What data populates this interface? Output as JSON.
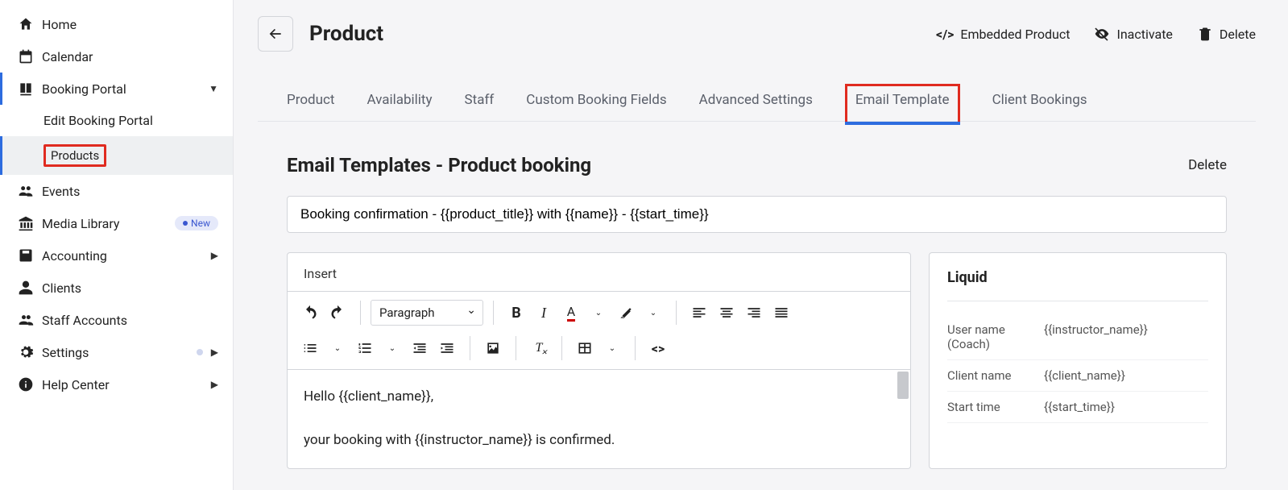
{
  "sidebar": {
    "items": [
      {
        "label": "Home"
      },
      {
        "label": "Calendar"
      },
      {
        "label": "Booking Portal"
      },
      {
        "label": "Edit Booking Portal"
      },
      {
        "label": "Products"
      },
      {
        "label": "Events"
      },
      {
        "label": "Media Library",
        "badge": "New"
      },
      {
        "label": "Accounting"
      },
      {
        "label": "Clients"
      },
      {
        "label": "Staff Accounts"
      },
      {
        "label": "Settings"
      },
      {
        "label": "Help Center"
      }
    ]
  },
  "header": {
    "title": "Product",
    "actions": {
      "embedded": "Embedded Product",
      "inactivate": "Inactivate",
      "delete": "Delete"
    }
  },
  "tabs": [
    "Product",
    "Availability",
    "Staff",
    "Custom Booking Fields",
    "Advanced Settings",
    "Email Template",
    "Client Bookings"
  ],
  "content": {
    "heading": "Email Templates - Product booking",
    "delete": "Delete",
    "subject": "Booking confirmation - {{product_title}} with {{name}} - {{start_time}}",
    "editor": {
      "insert": "Insert",
      "paragraph": "Paragraph",
      "body_line1": "Hello {{client_name}},",
      "body_line2": "your booking with {{instructor_name}} is confirmed."
    }
  },
  "liquid": {
    "title": "Liquid",
    "rows": [
      {
        "k": "User name (Coach)",
        "v": "{{instructor_name}}"
      },
      {
        "k": "Client name",
        "v": "{{client_name}}"
      },
      {
        "k": "Start time",
        "v": "{{start_time}}"
      }
    ]
  }
}
